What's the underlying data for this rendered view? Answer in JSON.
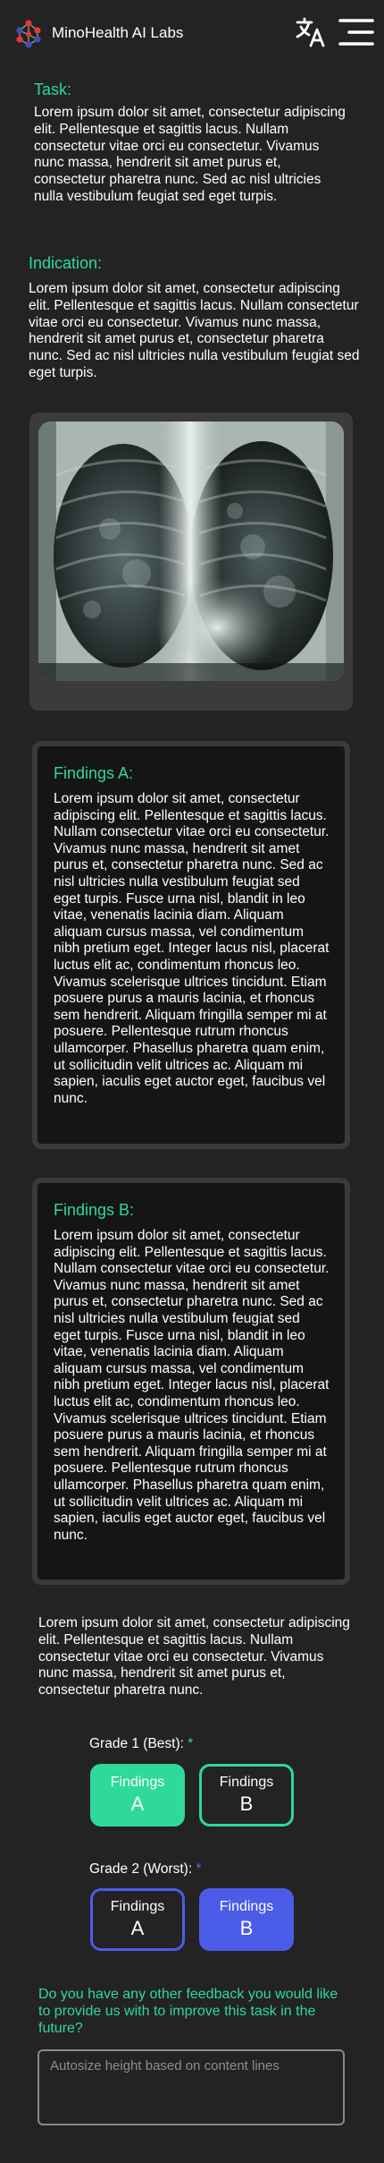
{
  "header": {
    "brand": "MinoHealth AI Labs",
    "logo_icon": "molecule-logo",
    "translate_icon": "translate-icon",
    "menu_icon": "hamburger-menu-icon"
  },
  "task": {
    "title": "Task:",
    "body": "Lorem ipsum dolor sit amet, consectetur adipiscing elit. Pellentesque et sagittis lacus. Nullam consectetur vitae orci eu consectetur. Vivamus nunc massa, hendrerit sit amet purus et, consectetur pharetra nunc. Sed ac nisl ultricies nulla vestibulum feugiat sed eget turpis."
  },
  "indication": {
    "title": "Indication:",
    "body": "Lorem ipsum dolor sit amet, consectetur adipiscing elit. Pellentesque et sagittis lacus. Nullam consectetur vitae orci eu consectetur. Vivamus nunc massa, hendrerit sit amet purus et, consectetur pharetra nunc. Sed ac nisl ultricies nulla vestibulum feugiat sed eget turpis."
  },
  "image": {
    "subject": "chest-xray"
  },
  "findings_a": {
    "title": "Findings A:",
    "body": "Lorem ipsum dolor sit amet, consectetur adipiscing elit. Pellentesque et sagittis lacus. Nullam consectetur vitae orci eu consectetur. Vivamus nunc massa, hendrerit sit amet purus et, consectetur pharetra nunc. Sed ac nisl ultricies nulla vestibulum feugiat sed eget turpis. Fusce urna nisl, blandit in leo vitae, venenatis lacinia diam. Aliquam aliquam cursus massa, vel condimentum nibh pretium eget. Integer lacus nisl, placerat luctus elit ac, condimentum rhoncus leo. Vivamus scelerisque ultrices tincidunt. Etiam posuere purus a mauris lacinia, et rhoncus sem hendrerit. Aliquam fringilla semper mi at posuere. Pellentesque rutrum rhoncus ullamcorper. Phasellus pharetra quam enim, ut sollicitudin velit ultrices ac. Aliquam mi sapien, iaculis eget auctor eget, faucibus vel nunc."
  },
  "findings_b": {
    "title": "Findings B:",
    "body": "Lorem ipsum dolor sit amet, consectetur adipiscing elit. Pellentesque et sagittis lacus. Nullam consectetur vitae orci eu consectetur. Vivamus nunc massa, hendrerit sit amet purus et, consectetur pharetra nunc. Sed ac nisl ultricies nulla vestibulum feugiat sed eget turpis. Fusce urna nisl, blandit in leo vitae, venenatis lacinia diam. Aliquam aliquam cursus massa, vel condimentum nibh pretium eget. Integer lacus nisl, placerat luctus elit ac, condimentum rhoncus leo. Vivamus scelerisque ultrices tincidunt. Etiam posuere purus a mauris lacinia, et rhoncus sem hendrerit. Aliquam fringilla semper mi at posuere. Pellentesque rutrum rhoncus ullamcorper. Phasellus pharetra quam enim, ut sollicitudin velit ultrices ac. Aliquam mi sapien, iaculis eget auctor eget, faucibus vel nunc."
  },
  "note": {
    "body": "Lorem ipsum dolor sit amet, consectetur adipiscing elit. Pellentesque et sagittis lacus. Nullam consectetur vitae orci eu consectetur. Vivamus nunc massa, hendrerit sit amet purus et, consectetur pharetra nunc."
  },
  "grade1": {
    "label": "Grade 1 (Best):",
    "required": "*",
    "option_a": {
      "line1": "Findings",
      "line2": "A",
      "selected": true
    },
    "option_b": {
      "line1": "Findings",
      "line2": "B",
      "selected": false
    }
  },
  "grade2": {
    "label": "Grade 2 (Worst):",
    "required": "*",
    "option_a": {
      "line1": "Findings",
      "line2": "A",
      "selected": false
    },
    "option_b": {
      "line1": "Findings",
      "line2": "B",
      "selected": true
    }
  },
  "feedback": {
    "question": "Do you have any other feedback you would like to provide us with to improve this task in the future?",
    "placeholder": "Autosize height based on content lines",
    "value": ""
  },
  "colors": {
    "background": "#232323",
    "accent_green": "#2fd99a",
    "accent_blue": "#4a5ce8",
    "card_dark": "#151515",
    "card_border": "#3a3a3a"
  }
}
